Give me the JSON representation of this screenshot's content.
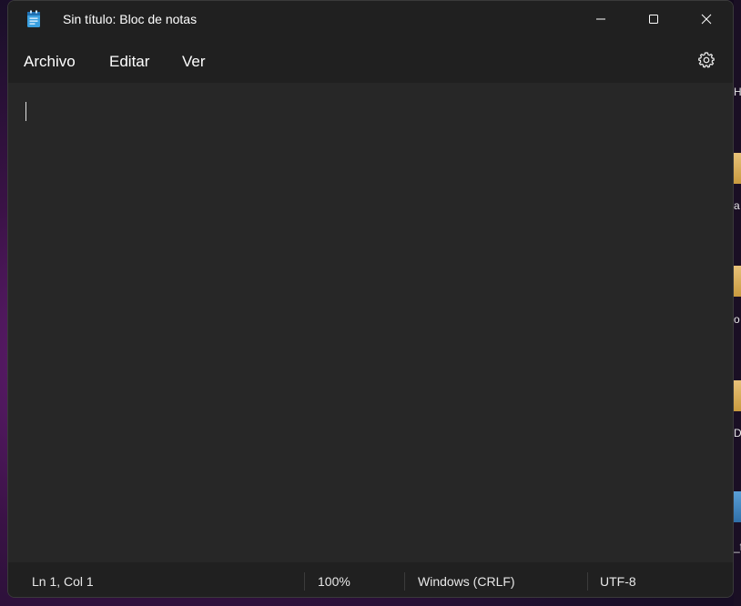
{
  "window": {
    "title": "Sin título: Bloc de notas",
    "app_icon": "notepad-icon",
    "controls": [
      "minimize-icon",
      "maximize-icon",
      "close-icon"
    ]
  },
  "menu": {
    "items": [
      "Archivo",
      "Editar",
      "Ver"
    ],
    "settings_icon": "gear-icon"
  },
  "editor": {
    "content": ""
  },
  "status": {
    "position": "Ln 1, Col 1",
    "zoom": "100%",
    "line_ending": "Windows (CRLF)",
    "encoding": "UTF-8"
  },
  "desktop": {
    "partial_labels": [
      "H",
      "a",
      "o",
      "D",
      "_f"
    ]
  }
}
